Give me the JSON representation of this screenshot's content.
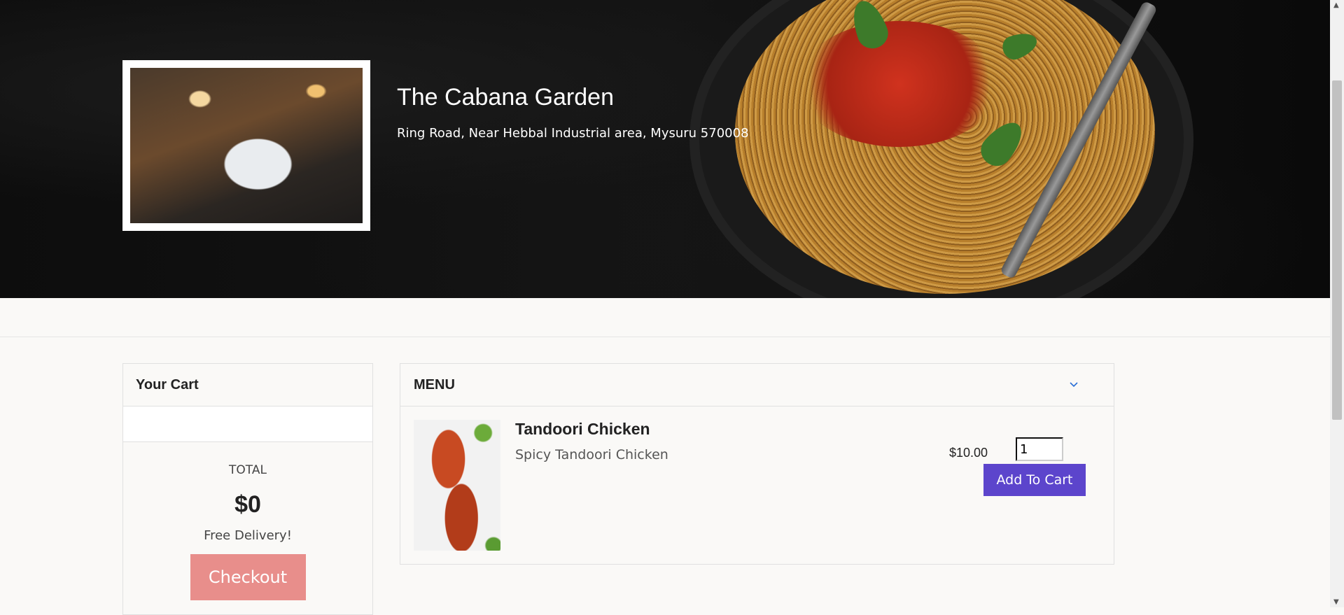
{
  "restaurant": {
    "name": "The Cabana Garden",
    "address": "Ring Road, Near Hebbal Industrial area, Mysuru 570008"
  },
  "cart": {
    "title": "Your Cart",
    "total_label": "TOTAL",
    "total_value": "$0",
    "delivery_note": "Free Delivery!",
    "checkout_label": "Checkout"
  },
  "menu": {
    "title": "MENU",
    "items": [
      {
        "name": "Tandoori Chicken",
        "description": "Spicy Tandoori Chicken",
        "price": "$10.00",
        "quantity": "1",
        "add_label": "Add To Cart"
      }
    ]
  },
  "colors": {
    "accent": "#5c45cc",
    "checkout": "#e88e8b",
    "hero_bg": "#0b0b0b"
  },
  "icons": {
    "menu_toggle": "chevron-down-icon"
  }
}
